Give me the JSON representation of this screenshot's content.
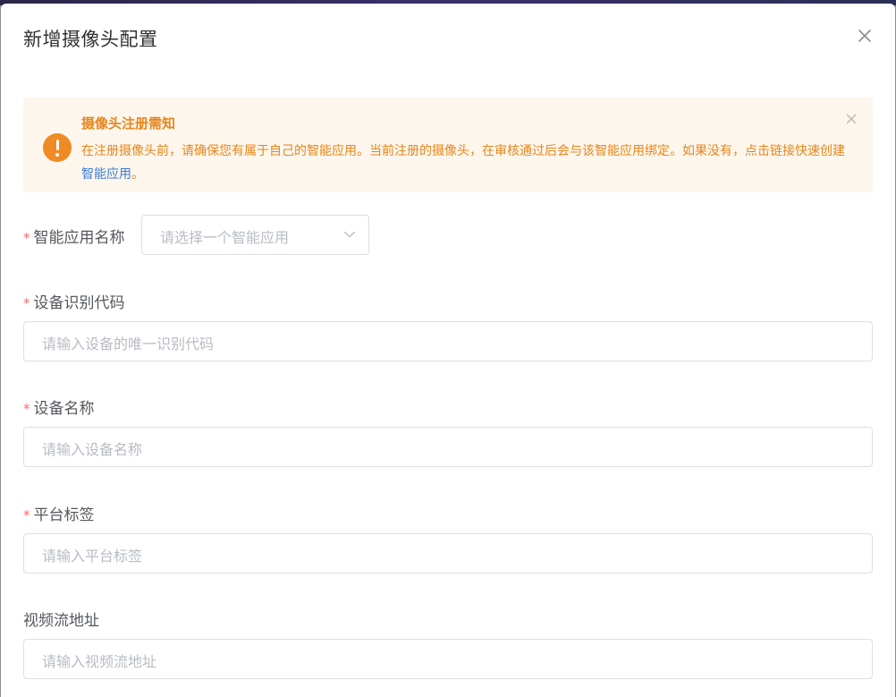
{
  "dialog": {
    "title": "新增摄像头配置"
  },
  "alert": {
    "title": "摄像头注册需知",
    "description": "在注册摄像头前，请确保您有属于自己的智能应用。当前注册的摄像头，在审核通过后会与该智能应用绑定。如果没有，点击链接快速创建",
    "link_label": "智能应用",
    "suffix": "。",
    "color": "#e6861c"
  },
  "form": {
    "required_mark": "*",
    "app_name": {
      "label": "智能应用名称",
      "placeholder": "请选择一个智能应用"
    },
    "device_code": {
      "label": "设备识别代码",
      "placeholder": "请输入设备的唯一识别代码"
    },
    "device_name": {
      "label": "设备名称",
      "placeholder": "请输入设备名称"
    },
    "platform_tag": {
      "label": "平台标签",
      "placeholder": "请输入平台标签"
    },
    "stream_url": {
      "label": "视频流地址",
      "placeholder": "请输入视频流地址"
    }
  },
  "icons": {
    "close": "close-icon",
    "warning": "warning-icon",
    "chevron": "chevron-down-icon"
  }
}
